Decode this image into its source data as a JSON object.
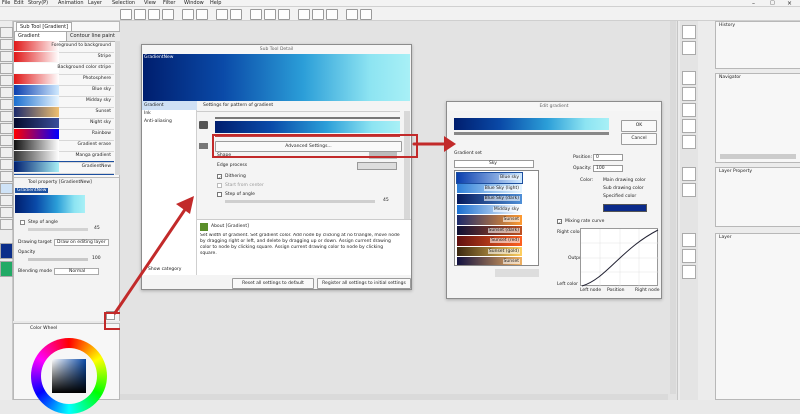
{
  "menu": [
    "File",
    "Edit",
    "Story(P)",
    "Animation",
    "Layer",
    "Selection",
    "View",
    "Filter",
    "Window",
    "Help"
  ],
  "left_panel": {
    "subtool_tab": "Sub Tool [Gradient]",
    "tabs": [
      "Gradient",
      "Contour line paint"
    ],
    "items": [
      {
        "label": "Foreground to background",
        "colors": [
          "#e01818",
          "#ffffff"
        ]
      },
      {
        "label": "Stripe",
        "colors": [
          "#e01818",
          "#ffffff"
        ]
      },
      {
        "label": "Background color stripe",
        "colors": [
          "#ffffff",
          "#ffffff"
        ]
      },
      {
        "label": "Photosphere",
        "colors": [
          "#e01818",
          "#ffffff"
        ]
      },
      {
        "label": "Blue sky",
        "colors": [
          "#0b3fae",
          "#cfe9ff"
        ]
      },
      {
        "label": "Midday sky",
        "colors": [
          "#1a6fd0",
          "#e9f6ff"
        ]
      },
      {
        "label": "Sunset",
        "colors": [
          "#1c2a6b",
          "#f0c070"
        ]
      },
      {
        "label": "Night sky",
        "colors": [
          "#050b2c",
          "#3b4f9c"
        ]
      },
      {
        "label": "Rainbow",
        "colors": [
          "#ff0000",
          "#0000ff"
        ]
      },
      {
        "label": "Gradient erase",
        "colors": [
          "#111111",
          "#ffffff"
        ]
      },
      {
        "label": "Manga gradient",
        "colors": [
          "#333333",
          "#ffffff"
        ]
      },
      {
        "label": "GradientNew",
        "colors": [
          "#001e6e",
          "#a8f0f6"
        ]
      }
    ],
    "tool_property": {
      "title": "Tool property [GradientNew]",
      "name": "GradientNew",
      "step_label": "Step of angle",
      "step_value": "45",
      "drawing_target_label": "Drawing target",
      "drawing_target_value": "Draw on editing layer",
      "opacity_label": "Opacity",
      "opacity_value": "100",
      "blending_label": "Blending mode",
      "blending_value": "Normal"
    },
    "color_wheel_title": "Color Wheel"
  },
  "subtool_detail": {
    "title": "Sub Tool Detail",
    "preview_name": "GradientNew",
    "categories": [
      "Gradient",
      "Ink",
      "Anti-aliasing"
    ],
    "settings_header": "Settings for pattern of gradient",
    "advanced_button": "Advanced Settings...",
    "shape_label": "Shape",
    "edge_label": "Edge process",
    "dithering_label": "Dithering",
    "start_center_label": "Start from center",
    "step_label": "Step of angle",
    "step_value": "45",
    "about_title": "About [Gradient]",
    "about_text": "Set width of gradient. Set gradient color. Add node by clicking at no triangle, move node by dragging right or left, and delete by dragging up or down. Assign current drawing color to node by clicking square. Assign current drawing color to node by clicking square.",
    "show_category": "Show category",
    "reset_button": "Reset all settings to default",
    "register_button": "Register all settings to initial settings"
  },
  "edit_gradient": {
    "title": "Edit gradient",
    "ok": "OK",
    "cancel": "Cancel",
    "gradient_set_label": "Gradient set",
    "set_value": "Sky",
    "position_label": "Position:",
    "position_value": "0",
    "opacity_label": "Opacity:",
    "opacity_value": "100",
    "color_label": "Color:",
    "color_options": [
      "Main drawing color",
      "Sub drawing color",
      "Specified color"
    ],
    "specified_color": "#0a2a8a",
    "mixing_label": "Mixing rate curve",
    "right_color": "Right color",
    "output": "Output",
    "left_color": "Left color",
    "axis": [
      "Left node",
      "Position",
      "Right node"
    ],
    "set_items": [
      {
        "label": "Blue sky",
        "colors": [
          "#0b3fae",
          "#cfe9ff"
        ]
      },
      {
        "label": "Blue Sky (light)",
        "colors": [
          "#2f80d8",
          "#e6f5ff"
        ]
      },
      {
        "label": "Blue Sky (dark)",
        "colors": [
          "#061a5c",
          "#4f90d8"
        ]
      },
      {
        "label": "Midday sky",
        "colors": [
          "#1a6fd0",
          "#ffffff"
        ]
      },
      {
        "label": "Sunset",
        "colors": [
          "#1c2a6b",
          "#ff9a30"
        ]
      },
      {
        "label": "Sunset (dark)",
        "colors": [
          "#0e1035",
          "#c05020"
        ]
      },
      {
        "label": "Sunset (red)",
        "colors": [
          "#601010",
          "#ff6020"
        ]
      },
      {
        "label": "Sunset (gold)",
        "colors": [
          "#3a2810",
          "#ffd060"
        ]
      },
      {
        "label": "Sunset",
        "colors": [
          "#101040",
          "#f0b060"
        ]
      }
    ]
  },
  "right_panel": {
    "history": "History",
    "navigator": "Navigator",
    "layer_property": "Layer Property",
    "layer": "Layer"
  },
  "annotation_color": "#c22a2a"
}
